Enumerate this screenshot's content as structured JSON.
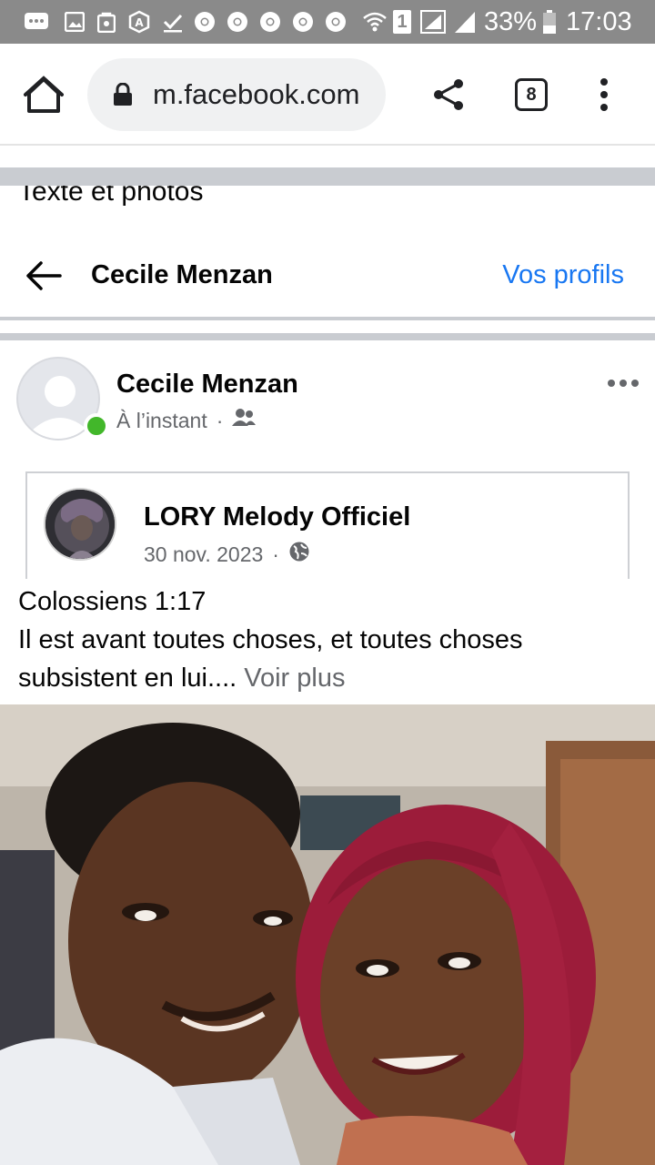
{
  "status_bar": {
    "battery": "33%",
    "time": "17:03",
    "sim_label": "1",
    "icons": [
      "chat-icon",
      "gallery-icon",
      "shop-icon",
      "app-icon",
      "check-icon",
      "chrome-icon",
      "chrome-icon",
      "chrome-icon",
      "chrome-icon",
      "chrome-icon",
      "wifi-icon",
      "signal-icon",
      "signal-icon",
      "battery-icon"
    ]
  },
  "browser": {
    "url": "m.facebook.com",
    "tab_count": "8",
    "icons": [
      "home-icon",
      "lock-icon",
      "share-icon",
      "tabs-icon",
      "more-vert-icon"
    ]
  },
  "partial_heading": "Texte et photos",
  "header": {
    "title": "Cecile Menzan",
    "link": "Vos profils",
    "back_icon": "arrow-left-icon"
  },
  "post": {
    "author": "Cecile Menzan",
    "time": "À l’instant",
    "audience_icon": "friends-icon",
    "shared": {
      "author": "LORY Melody Officiel",
      "date": "30 nov. 2023",
      "audience_icon": "globe-icon"
    },
    "text_line1": "Colossiens 1:17",
    "text_line2": "Il est avant toutes choses, et toutes choses subsistent en lui....",
    "see_more": " Voir plus"
  },
  "colors": {
    "accent": "#1877f2",
    "online": "#42b72a",
    "secondary_text": "#65676b",
    "status_bar": "#8a8a8a"
  }
}
